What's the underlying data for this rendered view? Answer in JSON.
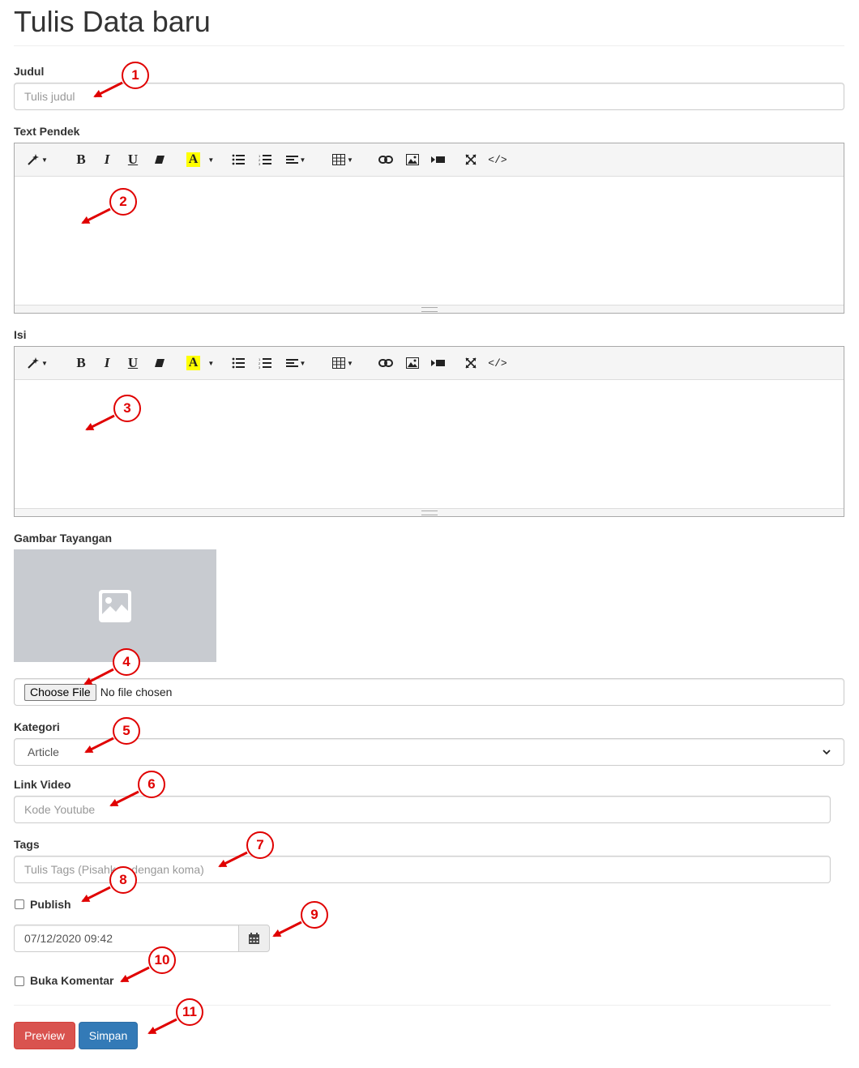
{
  "page": {
    "title": "Tulis Data baru"
  },
  "form": {
    "judul": {
      "label": "Judul",
      "placeholder": "Tulis judul"
    },
    "text_pendek": {
      "label": "Text Pendek"
    },
    "isi": {
      "label": "Isi"
    },
    "gambar": {
      "label": "Gambar Tayangan",
      "choose_label": "Choose File",
      "no_file": "No file chosen"
    },
    "kategori": {
      "label": "Kategori",
      "selected": "Article"
    },
    "link_video": {
      "label": "Link Video",
      "placeholder": "Kode Youtube"
    },
    "tags": {
      "label": "Tags",
      "placeholder": "Tulis Tags (Pisahkan dengan koma)"
    },
    "publish": {
      "label": "Publish",
      "checked": false
    },
    "datetime": {
      "value": "07/12/2020 09:42"
    },
    "komentar": {
      "label": "Buka Komentar",
      "checked": false
    }
  },
  "buttons": {
    "preview": "Preview",
    "simpan": "Simpan"
  },
  "toolbar_icons": [
    "magic-icon",
    "bold-icon",
    "italic-icon",
    "underline-icon",
    "eraser-icon",
    "font-color-icon",
    "unordered-list-icon",
    "ordered-list-icon",
    "align-icon",
    "table-icon",
    "link-icon",
    "image-icon",
    "video-icon",
    "fullscreen-icon",
    "code-view-icon"
  ],
  "callouts": [
    "1",
    "2",
    "3",
    "4",
    "5",
    "6",
    "7",
    "8",
    "9",
    "10",
    "11"
  ],
  "colors": {
    "callout": "#e00000",
    "preview_btn": "#d9534f",
    "simpan_btn": "#337ab7",
    "highlight": "#ffff00",
    "placeholder_image": "#c8cbd0"
  }
}
